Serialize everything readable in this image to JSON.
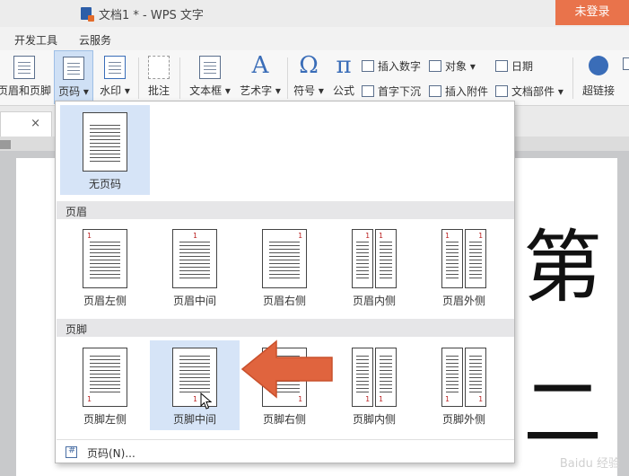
{
  "window": {
    "title": "文档1 * - WPS 文字",
    "login_label": "未登录"
  },
  "menu_tabs": [
    "开发工具",
    "云服务"
  ],
  "ribbon": {
    "header_footer": "页眉和页脚",
    "page_number": "页码 ▾",
    "watermark": "水印 ▾",
    "comment": "批注",
    "textbox": "文本框 ▾",
    "art_text": "艺术字 ▾",
    "symbol": "符号 ▾",
    "formula": "公式",
    "insert_number": "插入数字",
    "object": "对象 ▾",
    "date": "日期",
    "drop_cap": "首字下沉",
    "insert_attachment": "插入附件",
    "doc_parts": "文档部件 ▾",
    "hyperlink": "超链接"
  },
  "document": {
    "tab_close": "×",
    "big_chars": [
      "第",
      "二"
    ]
  },
  "dropdown": {
    "none": {
      "label": "无页码"
    },
    "header_section": "页眉",
    "header_options": [
      "页眉左侧",
      "页眉中间",
      "页眉右侧",
      "页眉内侧",
      "页眉外侧"
    ],
    "footer_section": "页脚",
    "footer_options": [
      "页脚左侧",
      "页脚中间",
      "页脚右侧",
      "页脚内侧",
      "页脚外侧"
    ],
    "page_number_dialog": "页码(N)...",
    "page_num_glyph": "1"
  },
  "watermark_text": "Baidu 经验",
  "colors": {
    "accent": "#e9734b",
    "selection": "#d6e4f7",
    "arrow": "#e0643e"
  }
}
